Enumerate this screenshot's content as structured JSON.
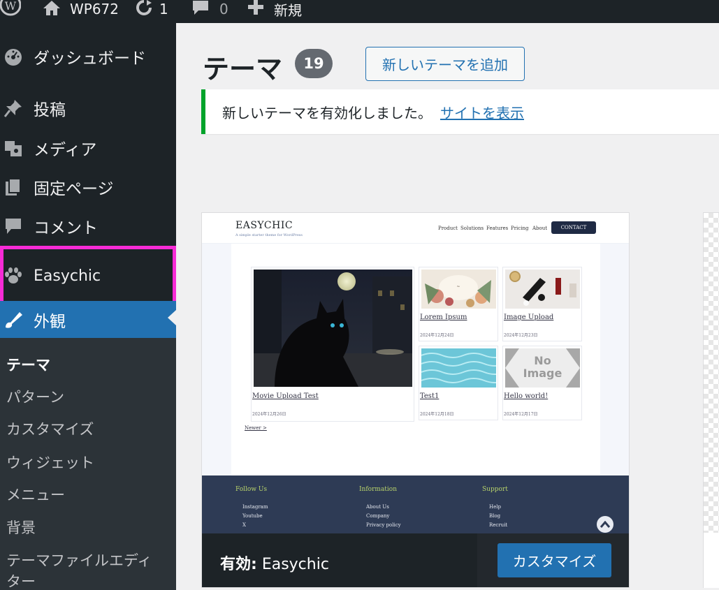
{
  "adminbar": {
    "site_name": "WP672",
    "updates_count": "1",
    "comments_count": "0",
    "new_label": "新規"
  },
  "sidebar": {
    "items": [
      {
        "label": "ダッシュボード",
        "icon": "dashboard-icon"
      },
      {
        "label": "投稿",
        "icon": "pin-icon"
      },
      {
        "label": "メディア",
        "icon": "media-icon"
      },
      {
        "label": "固定ページ",
        "icon": "pages-icon"
      },
      {
        "label": "コメント",
        "icon": "comment-icon"
      },
      {
        "label": "Easychic",
        "icon": "paw-icon"
      },
      {
        "label": "外観",
        "icon": "brush-icon"
      }
    ],
    "submenu": [
      {
        "label": "テーマ"
      },
      {
        "label": "パターン"
      },
      {
        "label": "カスタマイズ"
      },
      {
        "label": "ウィジェット"
      },
      {
        "label": "メニュー"
      },
      {
        "label": "背景"
      },
      {
        "label": "テーマファイルエディ"
      },
      {
        "label": "ター"
      }
    ]
  },
  "main": {
    "title": "テーマ",
    "theme_count": "19",
    "add_button": "新しいテーマを追加",
    "notice_text": "新しいテーマを有効化しました。",
    "notice_link": "サイトを表示"
  },
  "theme_card": {
    "active_prefix": "有効:",
    "active_name": "Easychic",
    "customize_button": "カスタマイズ",
    "preview": {
      "logo": "EASYCHIC",
      "tagline": "A simple starter theme for WordPress",
      "nav": [
        "Product",
        "Solutions",
        "Features",
        "Pricing",
        "About"
      ],
      "contact": "CONTACT",
      "posts": [
        {
          "title": "Movie Upload Test",
          "date": "2024年12月26日"
        },
        {
          "title": "Lorem Ipsum",
          "date": "2024年12月24日"
        },
        {
          "title": "Image Upload",
          "date": "2024年12月23日"
        },
        {
          "title": "Test1",
          "date": "2024年12月18日"
        },
        {
          "title": "Hello world!",
          "date": "2024年12月17日"
        }
      ],
      "no_image_line1": "No",
      "no_image_line2": "Image",
      "newer": "Newer >",
      "footer": {
        "col1_head": "Follow Us",
        "col1": [
          "Instagram",
          "Youtube",
          "X"
        ],
        "col2_head": "Information",
        "col2": [
          "About Us",
          "Company",
          "Privacy policy"
        ],
        "col3_head": "Support",
        "col3": [
          "Help",
          "Blog",
          "Recruit"
        ]
      }
    }
  },
  "colors": {
    "admin_dark": "#1d2327",
    "accent_blue": "#2271b1",
    "highlight_pink": "#f72bd6",
    "notice_green": "#00a32a"
  }
}
